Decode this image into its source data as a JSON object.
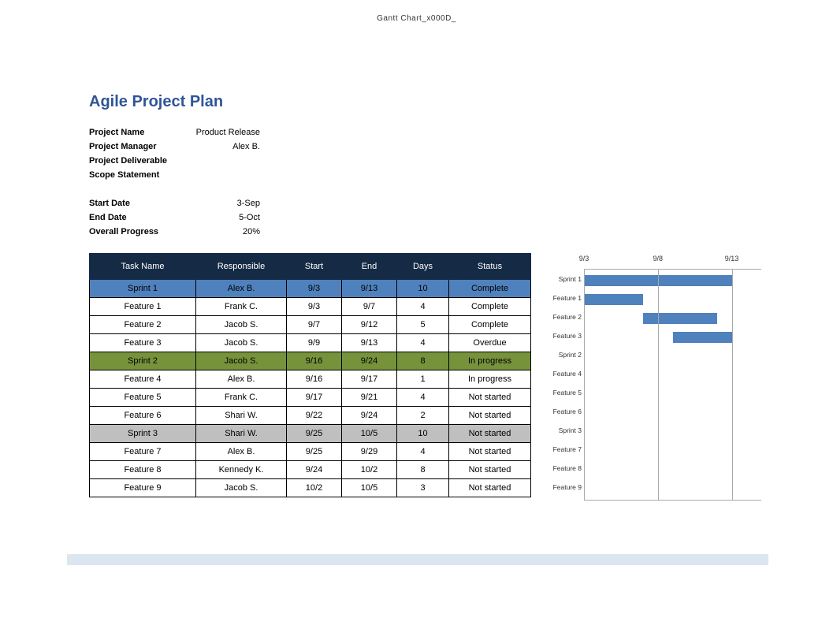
{
  "doc_title": "Gantt Chart_x000D_",
  "heading": "Agile Project Plan",
  "meta1": [
    {
      "label": "Project Name",
      "value": "Product Release"
    },
    {
      "label": "Project Manager",
      "value": "Alex B."
    },
    {
      "label": "Project Deliverable",
      "value": ""
    },
    {
      "label": "Scope Statement",
      "value": ""
    }
  ],
  "meta2": [
    {
      "label": "Start Date",
      "value": "3-Sep"
    },
    {
      "label": "End Date",
      "value": "5-Oct"
    },
    {
      "label": "Overall Progress",
      "value": "20%"
    }
  ],
  "columns": [
    "Task Name",
    "Responsible",
    "Start",
    "End",
    "Days",
    "Status"
  ],
  "tasks": [
    {
      "name": "Sprint 1",
      "responsible": "Alex B.",
      "start": "9/3",
      "end": "9/13",
      "days": "10",
      "status": "Complete",
      "class": "sprint-blue"
    },
    {
      "name": "Feature 1",
      "responsible": "Frank C.",
      "start": "9/3",
      "end": "9/7",
      "days": "4",
      "status": "Complete",
      "class": ""
    },
    {
      "name": "Feature 2",
      "responsible": "Jacob S.",
      "start": "9/7",
      "end": "9/12",
      "days": "5",
      "status": "Complete",
      "class": ""
    },
    {
      "name": "Feature 3",
      "responsible": "Jacob S.",
      "start": "9/9",
      "end": "9/13",
      "days": "4",
      "status": "Overdue",
      "class": ""
    },
    {
      "name": "Sprint 2",
      "responsible": "Jacob S.",
      "start": "9/16",
      "end": "9/24",
      "days": "8",
      "status": "In progress",
      "class": "sprint-green"
    },
    {
      "name": "Feature 4",
      "responsible": "Alex B.",
      "start": "9/16",
      "end": "9/17",
      "days": "1",
      "status": "In progress",
      "class": ""
    },
    {
      "name": "Feature 5",
      "responsible": "Frank C.",
      "start": "9/17",
      "end": "9/21",
      "days": "4",
      "status": "Not started",
      "class": ""
    },
    {
      "name": "Feature 6",
      "responsible": "Shari W.",
      "start": "9/22",
      "end": "9/24",
      "days": "2",
      "status": "Not started",
      "class": ""
    },
    {
      "name": "Sprint 3",
      "responsible": "Shari W.",
      "start": "9/25",
      "end": "10/5",
      "days": "10",
      "status": "Not started",
      "class": "sprint-grey"
    },
    {
      "name": "Feature 7",
      "responsible": "Alex B.",
      "start": "9/25",
      "end": "9/29",
      "days": "4",
      "status": "Not started",
      "class": ""
    },
    {
      "name": "Feature 8",
      "responsible": "Kennedy K.",
      "start": "9/24",
      "end": "10/2",
      "days": "8",
      "status": "Not started",
      "class": ""
    },
    {
      "name": "Feature 9",
      "responsible": "Jacob S.",
      "start": "10/2",
      "end": "10/5",
      "days": "3",
      "status": "Not started",
      "class": ""
    }
  ],
  "chart_data": {
    "type": "gantt",
    "title": "",
    "x_axis": {
      "min": 3,
      "max": 15,
      "ticks": [
        3,
        8,
        13
      ],
      "tick_labels": [
        "9/3",
        "9/8",
        "9/13"
      ]
    },
    "rows": [
      {
        "label": "Sprint 1",
        "start": 3,
        "end": 13
      },
      {
        "label": "Feature 1",
        "start": 3,
        "end": 7
      },
      {
        "label": "Feature 2",
        "start": 7,
        "end": 12
      },
      {
        "label": "Feature 3",
        "start": 9,
        "end": 13
      },
      {
        "label": "Sprint 2",
        "start": null,
        "end": null
      },
      {
        "label": "Feature 4",
        "start": null,
        "end": null
      },
      {
        "label": "Feature 5",
        "start": null,
        "end": null
      },
      {
        "label": "Feature 6",
        "start": null,
        "end": null
      },
      {
        "label": "Sprint 3",
        "start": null,
        "end": null
      },
      {
        "label": "Feature 7",
        "start": null,
        "end": null
      },
      {
        "label": "Feature 8",
        "start": null,
        "end": null
      },
      {
        "label": "Feature 9",
        "start": null,
        "end": null
      }
    ]
  }
}
